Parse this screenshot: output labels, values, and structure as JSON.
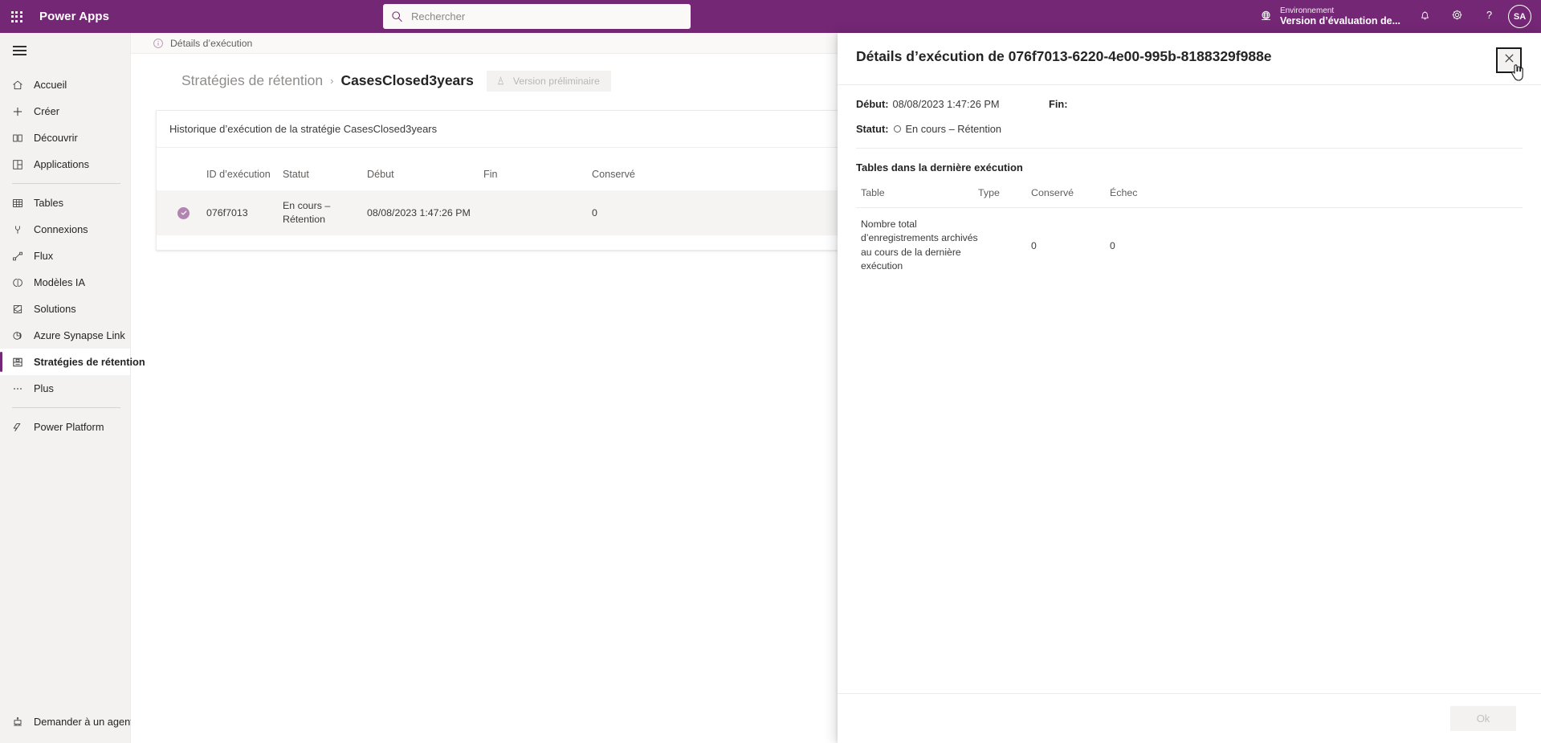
{
  "topbar": {
    "waffle_icon": "waffle-grid-icon",
    "brand": "Power Apps",
    "search": {
      "icon": "search-icon",
      "placeholder": "Rechercher",
      "value": ""
    },
    "environment": {
      "icon": "globe-icon",
      "label": "Environnement",
      "name": "Version d’évaluation de..."
    },
    "notifications_icon": "bell-icon",
    "settings_icon": "gear-icon",
    "help_icon": "question-mark-icon",
    "avatar_initials": "SA"
  },
  "sidebar": {
    "hamburger_icon": "hamburger-menu-icon",
    "items": [
      {
        "label": "Accueil",
        "icon": "home-icon",
        "active": false
      },
      {
        "label": "Créer",
        "icon": "plus-icon",
        "active": false
      },
      {
        "label": "Découvrir",
        "icon": "book-icon",
        "active": false
      },
      {
        "label": "Applications",
        "icon": "apps-grid-icon",
        "active": false
      },
      {
        "label": "Tables",
        "icon": "table-icon",
        "active": false
      },
      {
        "label": "Connexions",
        "icon": "plug-icon",
        "active": false
      },
      {
        "label": "Flux",
        "icon": "flow-icon",
        "active": false
      },
      {
        "label": "Modèles IA",
        "icon": "brain-icon",
        "active": false
      },
      {
        "label": "Solutions",
        "icon": "solutions-icon",
        "active": false
      },
      {
        "label": "Azure Synapse Link",
        "icon": "synapse-icon",
        "active": false
      },
      {
        "label": "Stratégies de rétention",
        "icon": "archive-icon",
        "active": true
      },
      {
        "label": "Plus",
        "icon": "ellipsis-icon",
        "active": false
      },
      {
        "label": "Power Platform",
        "icon": "power-platform-icon",
        "active": false
      }
    ],
    "bottom_item": {
      "label": "Demander à un agent virt",
      "icon": "robot-icon"
    }
  },
  "main": {
    "notification": {
      "icon": "info-circle-icon",
      "text": "Détails d’exécution"
    },
    "breadcrumb": {
      "parent": "Stratégies de rétention",
      "separator": "›",
      "current": "CasesClosed3years"
    },
    "preview_badge": {
      "icon": "traffic-cone-icon",
      "label": "Version préliminaire"
    },
    "card": {
      "title": "Historique d’exécution de la stratégie CasesClosed3years",
      "columns": [
        "",
        "ID d’exécution",
        "Statut",
        "Début",
        "Fin",
        "Conservé"
      ],
      "rows": [
        {
          "status_icon": "check-circle-icon",
          "id": "076f7013",
          "statut": "En cours – Rétention",
          "debut": "08/08/2023 1:47:26 PM",
          "fin": "",
          "conserve": "0"
        }
      ]
    }
  },
  "panel": {
    "title": "Détails d’exécution de 076f7013-6220-4e00-995b-8188329f988e",
    "close_icon": "close-x-icon",
    "cursor_icon": "pointer-hand-cursor",
    "meta": {
      "debut_label": "Début:",
      "debut_value": "08/08/2023 1:47:26 PM",
      "fin_label": "Fin:",
      "fin_value": "",
      "statut_label": "Statut:",
      "statut_icon": "in-progress-circle-icon",
      "statut_value": "En cours – Rétention"
    },
    "section_title": "Tables dans la dernière exécution",
    "table": {
      "columns": [
        "Table",
        "Type",
        "Conservé",
        "Échec"
      ],
      "rows": [
        {
          "table": "Nombre total d’enregistrements archivés au cours de la dernière exécution",
          "type": "",
          "conserve": "0",
          "echec": "0"
        }
      ]
    },
    "footer": {
      "ok_label": "Ok"
    }
  },
  "colors": {
    "brand_purple": "#742774",
    "accent_check": "#b284b2",
    "sidebar_bg": "#f3f2f1",
    "text_primary": "#242424",
    "text_secondary": "#605e5c"
  }
}
